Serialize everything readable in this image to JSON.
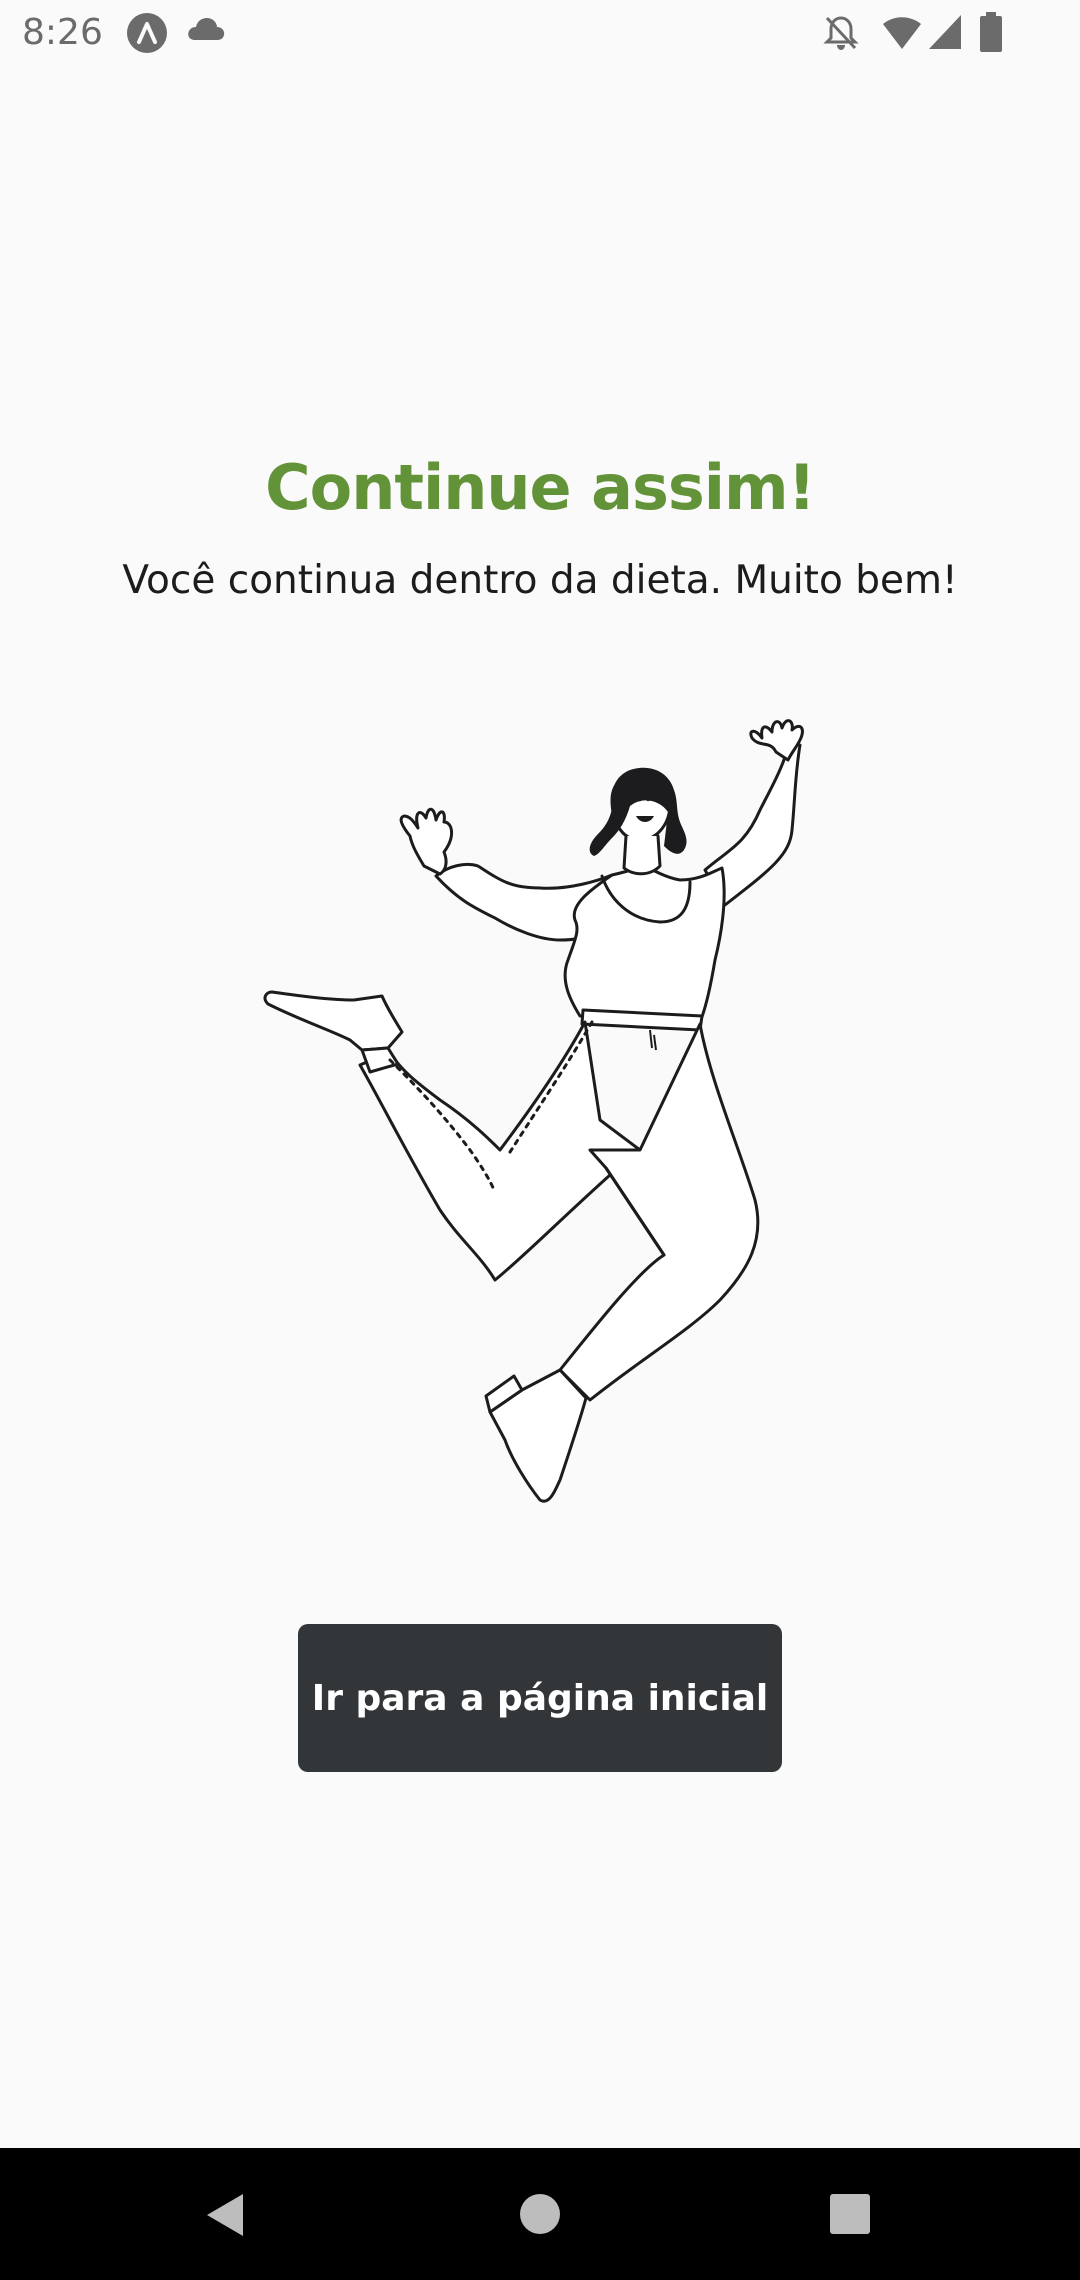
{
  "status_bar": {
    "time": "8:26",
    "icons": [
      "app-a-icon",
      "cloud-icon",
      "notifications-off-icon",
      "wifi-icon",
      "signal-icon",
      "battery-icon"
    ]
  },
  "feedback": {
    "title": "Continue assim!",
    "message": "Você continua dentro da dieta. Muito bem!",
    "illustration": "jumping-woman-illustration"
  },
  "actions": {
    "home_button_label": "Ir para a página inicial"
  },
  "navigation": {
    "icons": [
      "back-icon",
      "home-icon",
      "recents-icon"
    ]
  },
  "colors": {
    "title_green": "#639339",
    "button_dark": "#333638",
    "background": "#fafafa"
  }
}
